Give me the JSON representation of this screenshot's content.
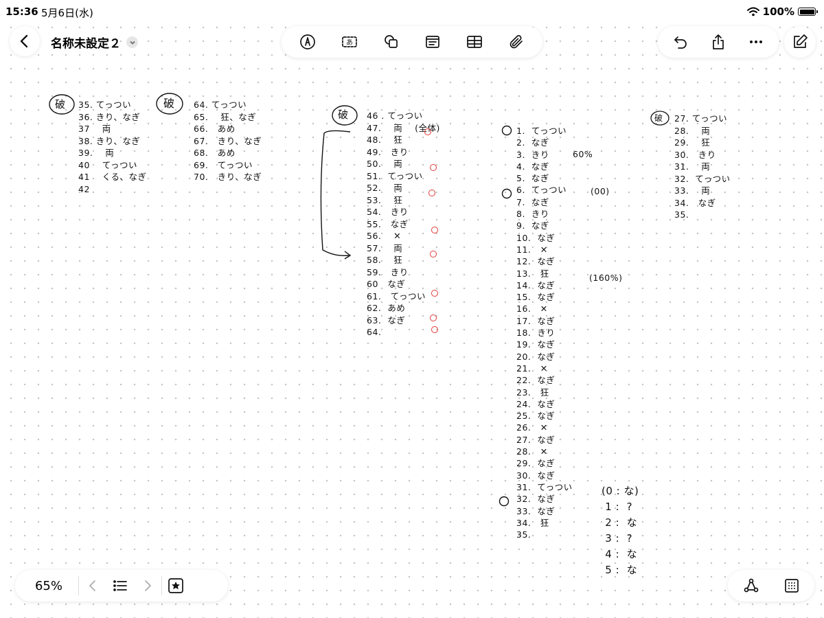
{
  "status": {
    "time": "15:36",
    "date": "5月6日(水)",
    "battery": "100%",
    "battery_level": 1.0
  },
  "toolbar": {
    "title": "名称未設定２"
  },
  "zoom": {
    "level": "65%"
  },
  "notes": {
    "col1_header": "破",
    "col1": "35. てっつい\n36. きり、なぎ\n37    両\n38. きり、なぎ\n39.    両\n40    てっつい\n41    くる、なぎ\n42",
    "col2_header": "破",
    "col2": "64. てっつい\n65.    狂、なぎ\n66.   あめ\n67.   きり、なぎ\n68.   あめ\n69.   てっつい\n70.   きり、なぎ",
    "col3_header": "破",
    "col3": "46 . てっつい\n47.    両    (全体)\n48.    狂\n49.   きり\n50.    両\n51.  てっつい\n52.    両\n53.    狂\n54.   きり\n55.   なぎ\n56.    ✕\n57.    両\n58.    狂\n59.   きり\n60   なぎ\n61.   てっつい\n62.  あめ\n63.  なぎ\n64.",
    "col4": "1.  てっつい\n2.  なぎ\n3.  きり\n4.  なぎ\n5.  なぎ\n6.  てっつい\n7.  なぎ\n8.  きり\n9.  なぎ\n10.  なぎ\n11.   ✕\n12.  なぎ\n13.   狂\n14.  なぎ\n15.  なぎ\n16.   ✕\n17.  なぎ\n18.  きり\n19.  なぎ\n20.  なぎ\n21.   ✕\n22.  なぎ\n23.   狂\n24.  なぎ\n25.  なぎ\n26.   ✕\n27.  なぎ\n28.   ✕\n29.  なぎ\n30.  なぎ\n31.  てっつい\n32.  なぎ\n33.  なぎ\n34.   狂\n35.",
    "note_60": "60%",
    "note_100": "(00)",
    "note_160": "(160%)",
    "col5_header": "破",
    "col5": "27. てっつい\n28.    両\n29.    狂\n30.   きり\n31.    両\n32.  てっつい\n33.    両\n34.   なぎ\n35.",
    "legend": "(0 : な)\n 1 :  ?\n 2 :  な\n 3 :  ?\n 4 :  な\n 5 :  な"
  },
  "colors": {
    "ink": "#111111",
    "red_ink": "#e03a3a",
    "grid_dot": "#c4c4c4"
  },
  "icons": {
    "back": "chevron-left-icon",
    "markup": "pen-icon",
    "textbox": "text-box-icon",
    "shapes": "shapes-icon",
    "text-format": "text-format-icon",
    "table": "table-icon",
    "attach": "paperclip-icon",
    "undo": "undo-icon",
    "share": "share-icon",
    "more": "ellipsis-icon",
    "new-note": "compose-icon",
    "prev": "chevron-left-icon",
    "list": "list-icon",
    "next": "chevron-right-icon",
    "favorite": "star-icon",
    "lasso": "lasso-icon",
    "grid": "grid-icon"
  }
}
